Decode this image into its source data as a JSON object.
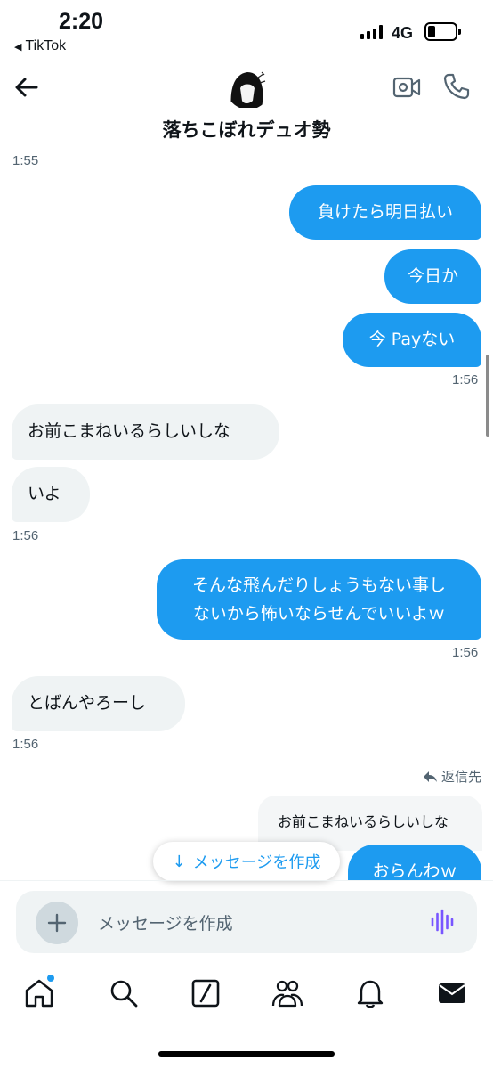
{
  "status_bar": {
    "time": "2:20",
    "back_app": "TikTok",
    "network": "4G"
  },
  "header": {
    "title": "落ちこぼれデュオ勢"
  },
  "messages": [
    {
      "time": "1:55"
    },
    {
      "text": "負けたら明日払い"
    },
    {
      "text": "今日か"
    },
    {
      "text": "今 Payない"
    },
    {
      "time": "1:56"
    },
    {
      "text": "お前こまねいるらしいしな"
    },
    {
      "text": "いよ"
    },
    {
      "time": "1:56"
    },
    {
      "line1": "そんな飛んだりしょうもない事し",
      "line2": "ないから怖いならせんでいいよｗ"
    },
    {
      "time": "1:56"
    },
    {
      "text": "とばんやろーし"
    },
    {
      "time": "1:56"
    },
    {
      "reply_label": "返信先",
      "quoted": "お前こまねいるらしいしな",
      "text": "おらんわｗ"
    }
  ],
  "new_message_button": {
    "label": "メッセージを作成"
  },
  "composer": {
    "placeholder": "メッセージを作成"
  },
  "colors": {
    "accent": "#1d9bf0",
    "bubble_received": "#eff3f4",
    "mic": "#7856ff"
  },
  "tabs": [
    "home-icon",
    "search-icon",
    "grok-icon",
    "communities-icon",
    "notifications-icon",
    "messages-icon"
  ]
}
